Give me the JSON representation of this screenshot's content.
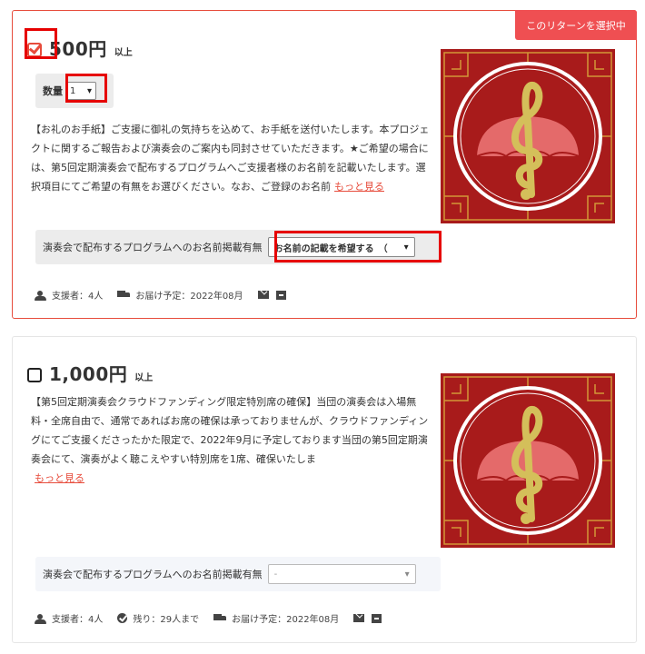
{
  "colors": {
    "accent": "#e74c3c",
    "thumb_bg": "#a81b1b",
    "clef": "#d4bf5a"
  },
  "rewards": [
    {
      "selected_badge": "このリターンを選択中",
      "checked": true,
      "price": "500円",
      "price_suffix": "以上",
      "quantity_label": "数量",
      "quantity_value": "1",
      "description": "【お礼のお手紙】ご支援に御礼の気持ちを込めて、お手紙を送付いたします。本プロジェクトに関するご報告および演奏会のご案内も同封させていただきます。★ご希望の場合には、第5回定期演奏会で配布するプログラムへご支援者様のお名前を記載いたします。選択項目にてご希望の有無をお選びください。なお、ご登録のお名前",
      "more_link": "もっと見る",
      "option_label": "演奏会で配布するプログラムへのお名前掲載有無",
      "option_value": "お名前の記載を希望する　（",
      "supporters": "支援者：4人",
      "delivery": "お届け予定：2022年08月",
      "thumb_icon": "treble-clef-icon"
    },
    {
      "checked": false,
      "price": "1,000円",
      "price_suffix": "以上",
      "description": "【第5回定期演奏会クラウドファンディング限定特別席の確保】当団の演奏会は入場無料・全席自由で、通常であればお席の確保は承っておりませんが、クラウドファンディングにてご支援くださったかた限定で、2022年9月に予定しております当団の第5回定期演奏会にて、演奏がよく聴こえやすい特別席を1席、確保いたしま",
      "more_link": "もっと見る",
      "option_label": "演奏会で配布するプログラムへのお名前掲載有無",
      "option_value": "-",
      "supporters": "支援者：4人",
      "remaining": "残り：29人まで",
      "delivery": "お届け予定：2022年08月",
      "thumb_icon": "treble-clef-icon"
    }
  ]
}
